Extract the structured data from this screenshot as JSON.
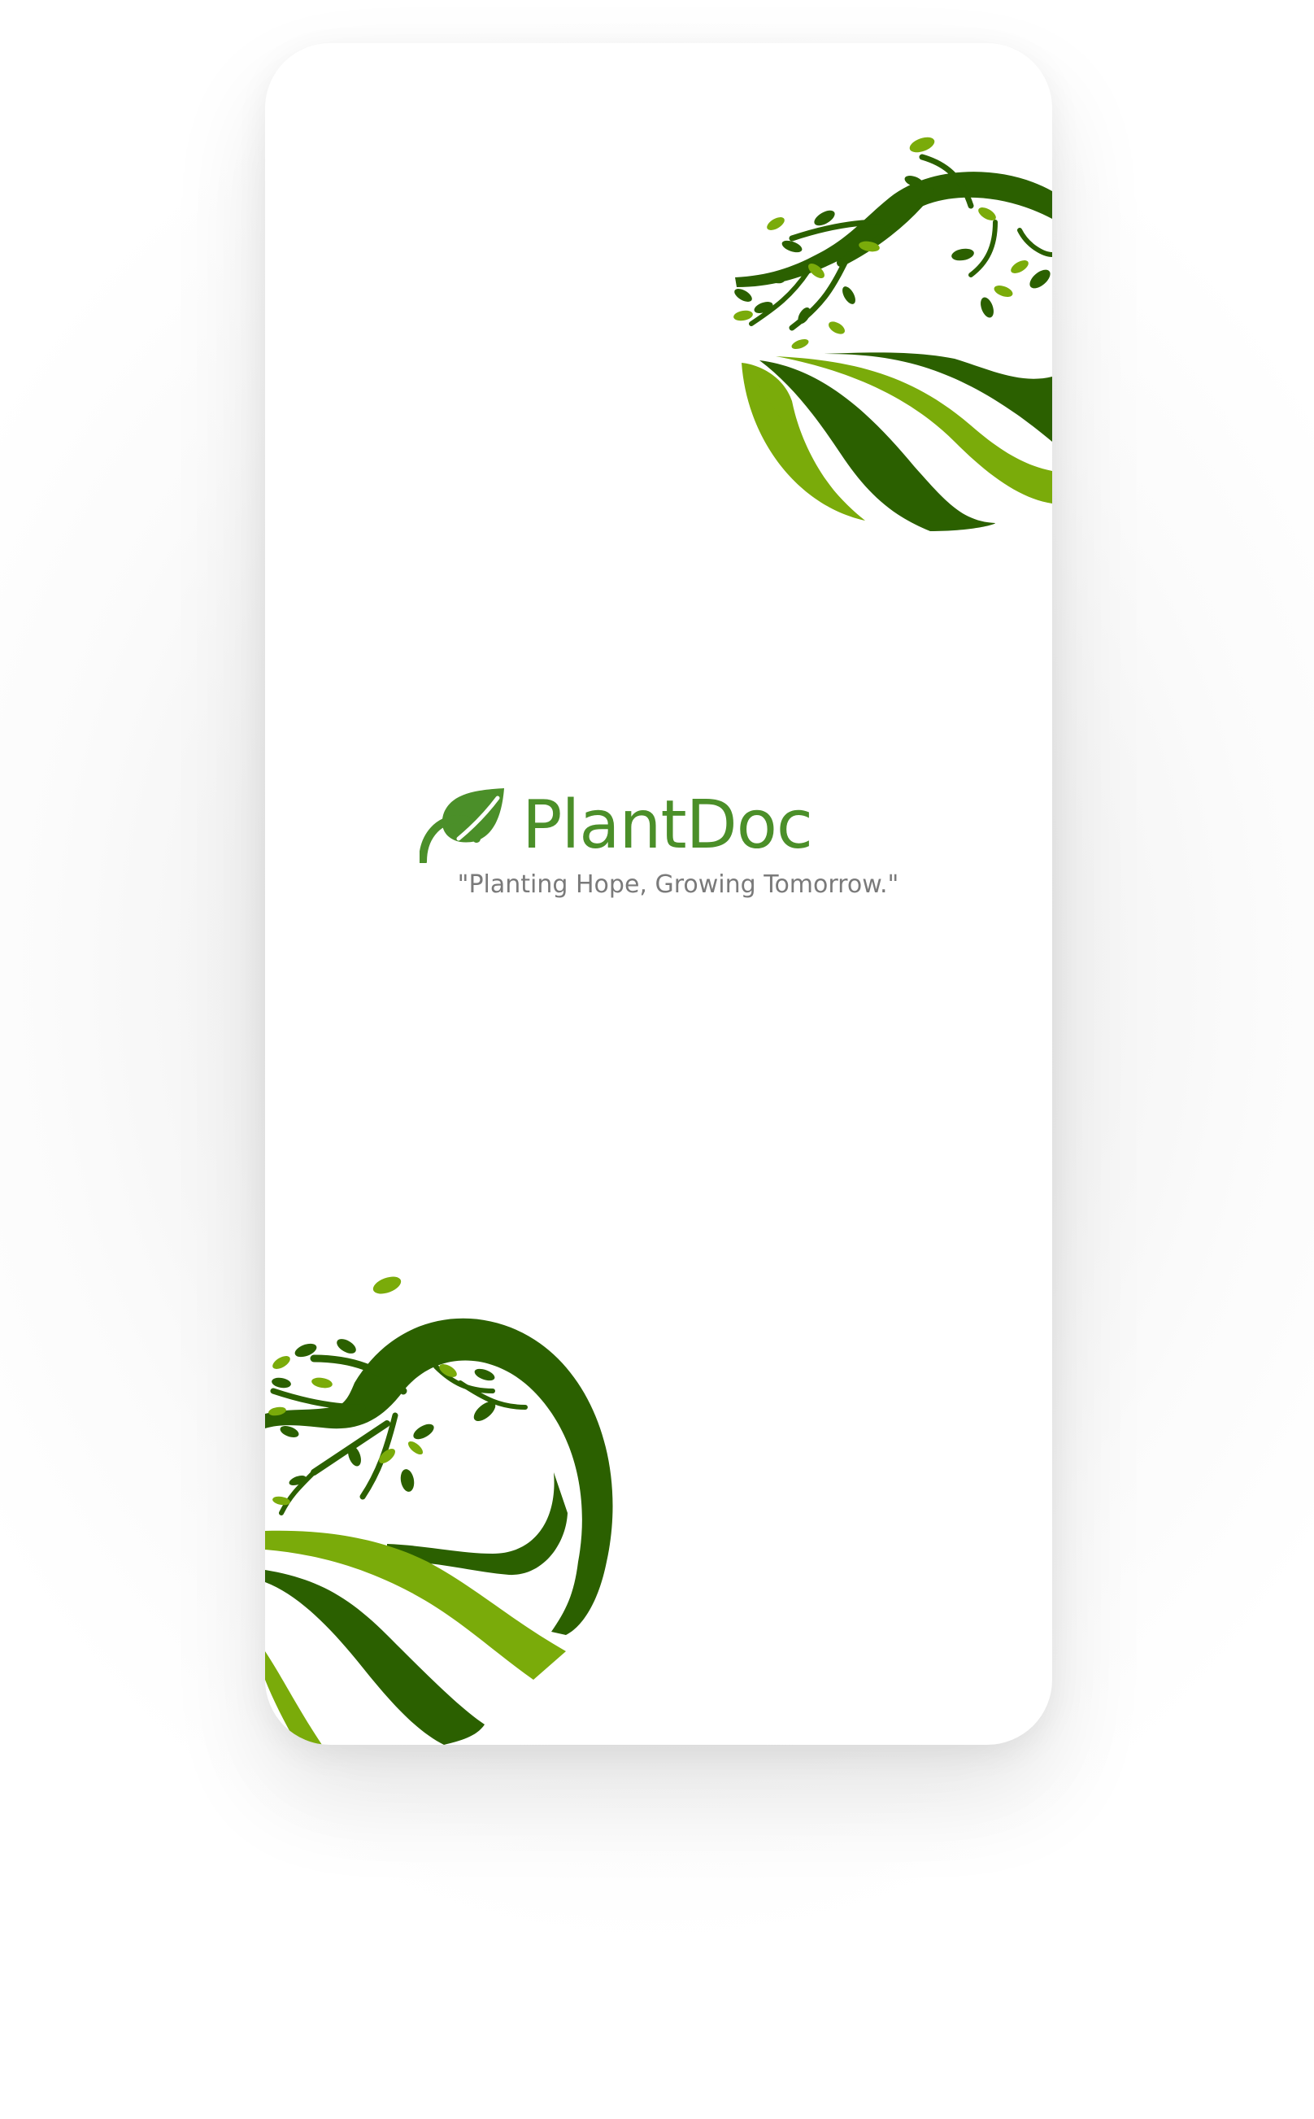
{
  "app": {
    "name": "PlantDoc",
    "tagline": "\"Planting Hope, Growing Tomorrow.\""
  },
  "icons": {
    "brand_logo": "leaf-icon",
    "top_decoration": "tree-landscape-decoration",
    "bottom_decoration": "tree-landscape-decoration"
  },
  "colors": {
    "brand_green": "#4b8f29",
    "dark_green": "#2b6000",
    "light_green": "#7aab0a",
    "tagline_gray": "#7a7a7a"
  }
}
